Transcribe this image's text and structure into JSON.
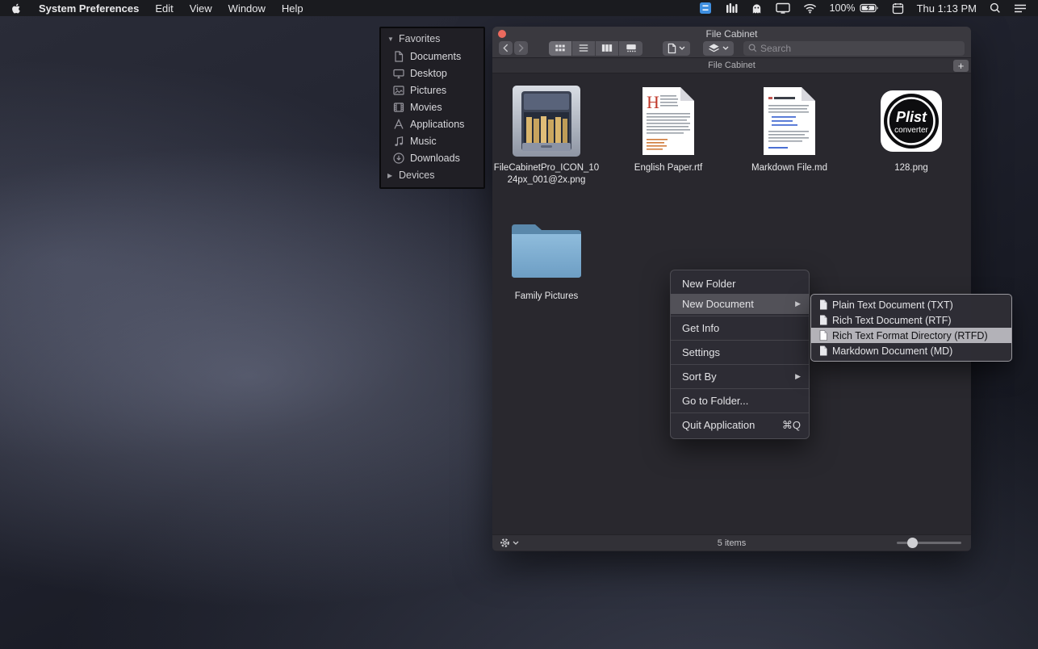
{
  "glyphs": {
    "tri_down": "▼",
    "tri_right": "▶"
  },
  "menubar": {
    "app_name": "System Preferences",
    "menus": [
      "Edit",
      "View",
      "Window",
      "Help"
    ],
    "battery": "100%",
    "clock": "Thu 1:13 PM"
  },
  "sidebar": {
    "favorites_label": "Favorites",
    "devices_label": "Devices",
    "items": [
      {
        "label": "Documents"
      },
      {
        "label": "Desktop"
      },
      {
        "label": "Pictures"
      },
      {
        "label": "Movies"
      },
      {
        "label": "Applications"
      },
      {
        "label": "Music"
      },
      {
        "label": "Downloads"
      }
    ]
  },
  "window": {
    "title": "File Cabinet",
    "path_label": "File Cabinet",
    "search_placeholder": "Search",
    "plus_label": "+",
    "items_count": "5 items",
    "files": [
      {
        "name": "FileCabinetPro_ICON_1024px_001@2x.png"
      },
      {
        "name": "English Paper.rtf",
        "dropcap": "H"
      },
      {
        "name": "Markdown File.md"
      },
      {
        "name": "128.png",
        "logo_line1": "Plist",
        "logo_line2": "converter"
      },
      {
        "name": "Family Pictures"
      }
    ]
  },
  "context_menu": {
    "items": [
      {
        "label": "New Folder"
      },
      {
        "label": "New Document"
      },
      {
        "label": "Get Info"
      },
      {
        "label": "Settings"
      },
      {
        "label": "Sort By"
      },
      {
        "label": "Go to Folder..."
      },
      {
        "label": "Quit Application",
        "shortcut": "⌘Q"
      }
    ]
  },
  "submenu": {
    "items": [
      {
        "label": "Plain Text Document (TXT)"
      },
      {
        "label": "Rich Text Document (RTF)"
      },
      {
        "label": "Rich Text Format Directory (RTFD)"
      },
      {
        "label": "Markdown Document (MD)"
      }
    ]
  }
}
